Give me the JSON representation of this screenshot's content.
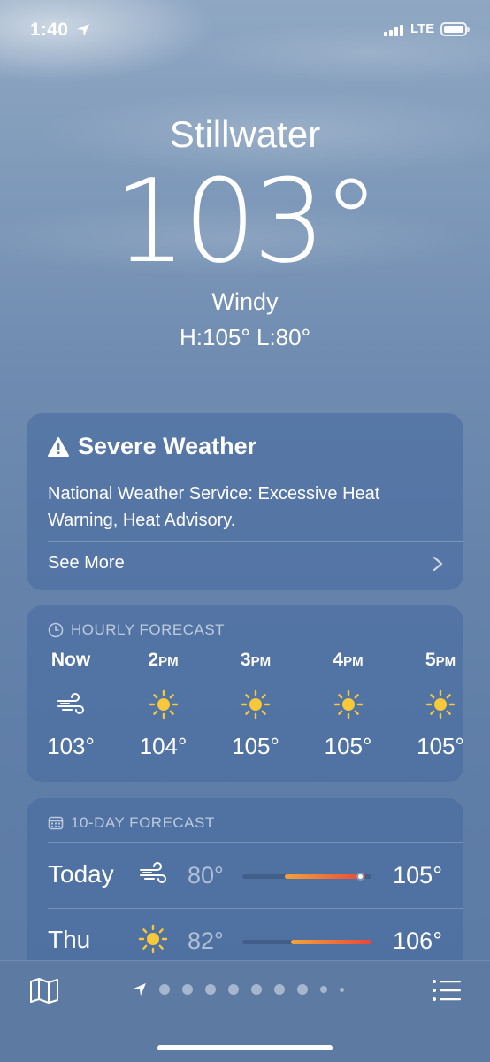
{
  "status_bar": {
    "time": "1:40",
    "network": "LTE"
  },
  "location": {
    "city": "Stillwater",
    "temperature": "103°",
    "condition": "Windy",
    "hi_lo": "H:105°  L:80°"
  },
  "alert": {
    "title": "Severe Weather",
    "body": "National Weather Service: Excessive Heat Warning, Heat Advisory.",
    "see_more": "See More"
  },
  "hourly": {
    "header": "HOURLY FORECAST",
    "items": [
      {
        "time": "Now",
        "suffix": "",
        "icon": "wind-icon",
        "temp": "103°"
      },
      {
        "time": "2",
        "suffix": "PM",
        "icon": "sun-icon",
        "temp": "104°"
      },
      {
        "time": "3",
        "suffix": "PM",
        "icon": "sun-icon",
        "temp": "105°"
      },
      {
        "time": "4",
        "suffix": "PM",
        "icon": "sun-icon",
        "temp": "105°"
      },
      {
        "time": "5",
        "suffix": "PM",
        "icon": "sun-icon",
        "temp": "105°"
      }
    ]
  },
  "ten_day": {
    "header": "10-DAY FORECAST",
    "days": [
      {
        "day": "Today",
        "icon": "wind-icon",
        "low": "80°",
        "high": "105°",
        "bar_start": 0.33,
        "bar_end": 0.95,
        "current_marker": 0.91
      },
      {
        "day": "Thu",
        "icon": "sun-icon",
        "low": "82°",
        "high": "106°",
        "bar_start": 0.38,
        "bar_end": 1.0
      }
    ]
  },
  "colors": {
    "accent_warm": "#e8473a",
    "accent_yellow": "#f6c83a"
  }
}
